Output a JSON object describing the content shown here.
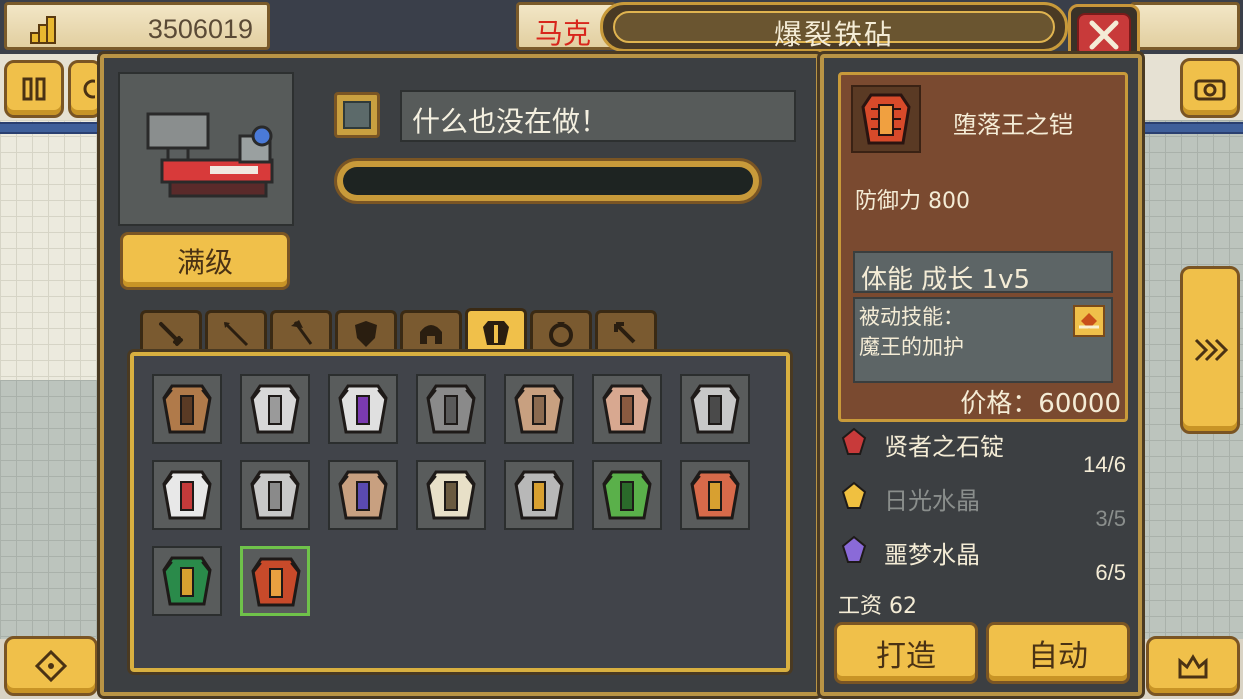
{
  "header": {
    "gold": "3506019",
    "character_name": "马克",
    "window_title": "爆裂铁砧"
  },
  "forge": {
    "upgrade_label": "满级",
    "status_text": "什么也没在做！",
    "progress": 0
  },
  "tabs": [
    {
      "icon": "sword-icon",
      "active": false
    },
    {
      "icon": "spear-icon",
      "active": false
    },
    {
      "icon": "axe-icon",
      "active": false
    },
    {
      "icon": "shield-icon",
      "active": false
    },
    {
      "icon": "helmet-icon",
      "active": false
    },
    {
      "icon": "armor-icon",
      "active": true
    },
    {
      "icon": "ring-icon",
      "active": false
    },
    {
      "icon": "bow-icon",
      "active": false
    }
  ],
  "armors": [
    {
      "color": "#b07a4a",
      "accent": "#5a3a24",
      "selected": false
    },
    {
      "color": "#d8d8d8",
      "accent": "#9a9a9a",
      "selected": false
    },
    {
      "color": "#e0e0e0",
      "accent": "#7a3ab0",
      "selected": false
    },
    {
      "color": "#8a8a8a",
      "accent": "#5a5a5a",
      "selected": false
    },
    {
      "color": "#c8a080",
      "accent": "#8a6a50",
      "selected": false
    },
    {
      "color": "#d8a890",
      "accent": "#8a5a40",
      "selected": false
    },
    {
      "color": "#c8c8c8",
      "accent": "#4a4a4a",
      "selected": false
    },
    {
      "color": "#e8e8e8",
      "accent": "#c43a3a",
      "selected": false
    },
    {
      "color": "#c8c8c8",
      "accent": "#8a8a8a",
      "selected": false
    },
    {
      "color": "#c8a080",
      "accent": "#5a4ab0",
      "selected": false
    },
    {
      "color": "#e8e0c8",
      "accent": "#6a5a40",
      "selected": false
    },
    {
      "color": "#b8b8b8",
      "accent": "#d8a030",
      "selected": false
    },
    {
      "color": "#5ab04a",
      "accent": "#2a6a2a",
      "selected": false
    },
    {
      "color": "#d86a4a",
      "accent": "#d8a030",
      "selected": false
    },
    {
      "color": "#2a8a4a",
      "accent": "#d8a030",
      "selected": false
    },
    {
      "color": "#c84a2a",
      "accent": "#e8a040",
      "selected": true
    }
  ],
  "item": {
    "name": "堕落王之铠",
    "defense": "防御力 800",
    "growth": "体能 成长 1v5",
    "passive_label": "被动技能：",
    "passive_value": "魔王的加护",
    "price": "价格：60000"
  },
  "materials": [
    {
      "name": "贤者之石锭",
      "count": "14/6",
      "dim": false,
      "icon_color": "#c83a3a"
    },
    {
      "name": "日光水晶",
      "count": "3/5",
      "dim": true,
      "icon_color": "#f0c040"
    },
    {
      "name": "噩梦水晶",
      "count": "6/5",
      "dim": false,
      "icon_color": "#8a6ad8"
    }
  ],
  "wage": "工资 62",
  "actions": {
    "craft_label": "打造",
    "auto_label": "自动"
  }
}
